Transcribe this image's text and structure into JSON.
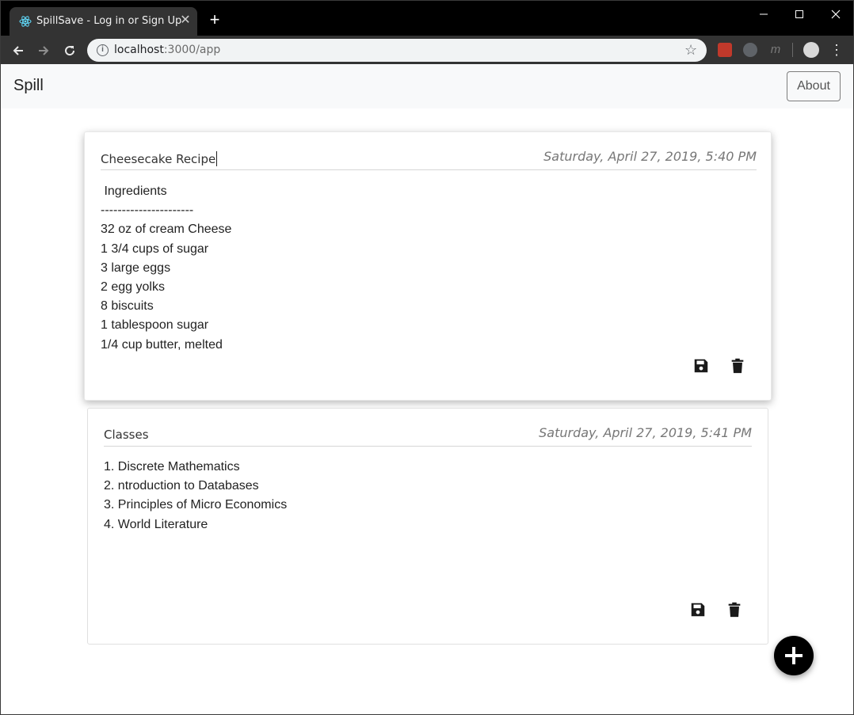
{
  "browser": {
    "tab_title": "SpillSave - Log in or Sign Up",
    "tab_close": "✕",
    "new_tab": "+",
    "url_host": "localhost",
    "url_path": ":3000/app",
    "ext_3_label": "m"
  },
  "navbar": {
    "brand": "Spill",
    "about_label": "About"
  },
  "notes": [
    {
      "title": "Cheesecake Recipe",
      "date": "Saturday, April 27, 2019, 5:40 PM",
      "lines": [
        " Ingredients",
        "----------------------",
        "32 oz of cream Cheese",
        "1 3/4 cups of sugar",
        "3 large eggs",
        "2 egg yolks",
        "8 biscuits",
        "1 tablespoon sugar",
        "1/4 cup butter, melted"
      ]
    },
    {
      "title": "Classes",
      "date": "Saturday, April 27, 2019, 5:41 PM",
      "lines": [
        "1. Discrete Mathematics",
        "2. ntroduction to Databases",
        "3. Principles of Micro Economics",
        "4. World Literature"
      ]
    }
  ],
  "icons": {
    "save": "save-icon",
    "delete": "trash-icon",
    "add": "plus-icon"
  },
  "colors": {
    "titlebar": "#000000",
    "toolbar": "#333333",
    "navbar_bg": "#f8f9fa",
    "fab": "#000000"
  }
}
